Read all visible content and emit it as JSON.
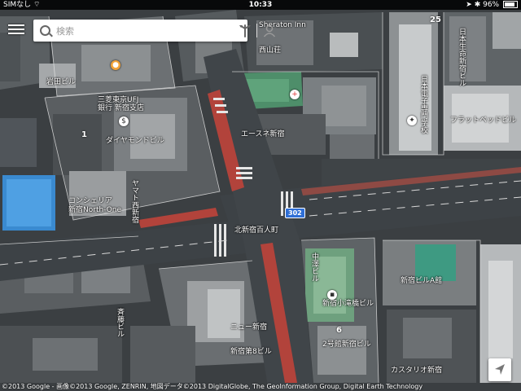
{
  "status_bar": {
    "carrier": "SIMなし",
    "time": "10:33",
    "battery": "96%"
  },
  "search": {
    "placeholder": "検索"
  },
  "map": {
    "labels": {
      "sheraton_inn": "Sheraton Inn",
      "building_top": "西山荘",
      "iwata_bldg": "岩田ビル",
      "mufg_bank": "三菱東京UFJ\n銀行 新宿支店",
      "diamond_bldg": "ダイヤモンドビル",
      "concierge": "コンシェリア",
      "concierge_north": "新宿North-One",
      "omoide": "ヤマト西新宿",
      "ace_cinema": "エースネ新宿",
      "nishi_shinjuku_bldg": "日本生命新宿ビル",
      "kanto_gakuin": "日本電子専門学校",
      "flamme_bldg": "フラットベッドビル",
      "kita_shinjuku_crossing": "北新宿百人町",
      "bunka_bldg": "新宿ビルA館",
      "yamanote_bldg": "中澤ビル",
      "nishi_shinjuku_6": "新宿小滝橋ビル",
      "ogikubo_bldg": "2号館新宿ビル",
      "shinjuku_bldg": "新宿第8ビル",
      "cass_bldg": "カスタリオ新宿",
      "tokyo_bldg": "斉藤ビル",
      "new_shinjuku": "ニュー新宿"
    },
    "block_numbers": {
      "b25": "25",
      "b1": "1",
      "b6": "6"
    },
    "route_number": "302"
  },
  "attribution": "©2013 Google - 画像©2013 Google, ZENRIN, 地図データ©2013 DigitalGlobe, The GeoInformation Group, Digital Earth Technology",
  "icons": {
    "menu": "menu-icon",
    "search": "search-icon",
    "directions": "directions-icon",
    "account": "account-icon",
    "compass": "location-arrow-icon"
  },
  "colors": {
    "road": "#3d4246",
    "road_red": "#b2433b",
    "roof_light": "#a8acae",
    "roof_dark": "#4a4f52",
    "roof_green": "#4e8e6a",
    "roof_blue": "#3a8ad0",
    "route_shield": "#2f6fd6"
  }
}
